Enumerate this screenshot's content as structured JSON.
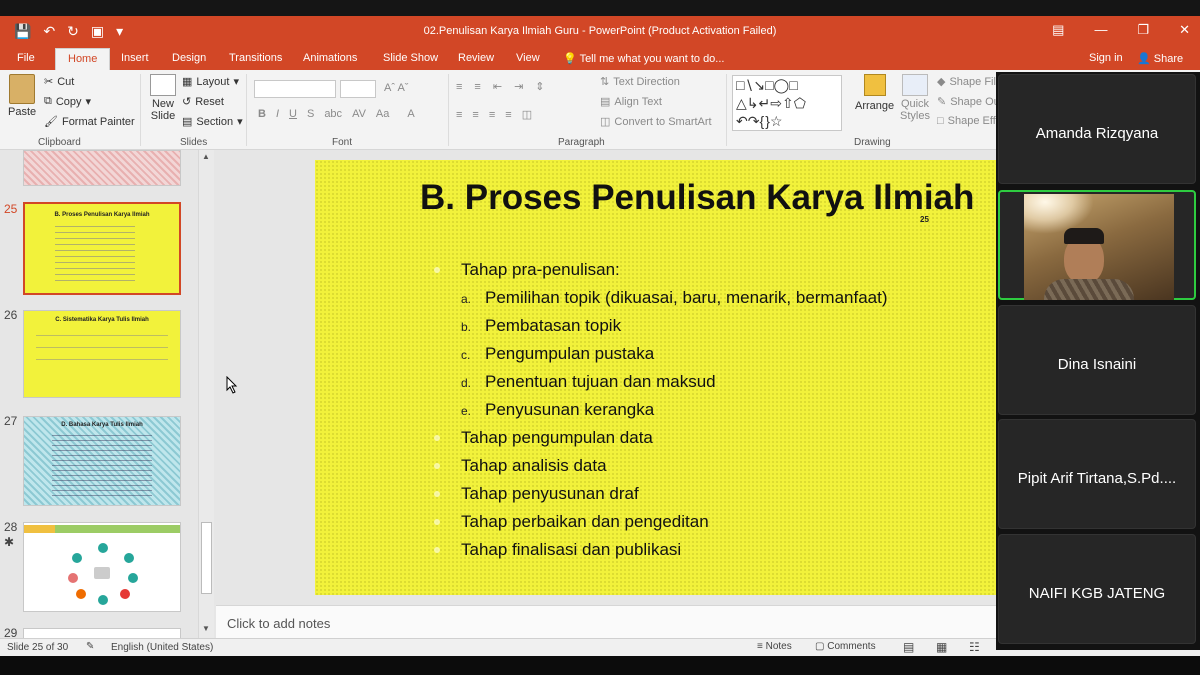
{
  "window": {
    "title": "02.Penulisan Karya Ilmiah Guru - PowerPoint (Product Activation Failed)"
  },
  "menu": {
    "tabs": [
      "File",
      "Home",
      "Insert",
      "Design",
      "Transitions",
      "Animations",
      "Slide Show",
      "Review",
      "View"
    ],
    "tell_me": "Tell me what you want to do...",
    "sign_in": "Sign in",
    "share": "Share"
  },
  "ribbon": {
    "clipboard": {
      "paste": "Paste",
      "cut": "Cut",
      "copy": "Copy",
      "format_painter": "Format Painter",
      "label": "Clipboard"
    },
    "slides": {
      "new_slide": "New Slide",
      "layout": "Layout",
      "reset": "Reset",
      "section": "Section",
      "label": "Slides"
    },
    "font": {
      "label": "Font",
      "case": "Aa"
    },
    "paragraph": {
      "text_direction": "Text Direction",
      "align_text": "Align Text",
      "convert": "Convert to SmartArt",
      "label": "Paragraph"
    },
    "drawing": {
      "arrange": "Arrange",
      "quick_styles": "Quick Styles",
      "shape_fill": "Shape Fill",
      "shape_outline": "Shape Outline",
      "shape_effects": "Shape Effects",
      "label": "Drawing"
    }
  },
  "thumbnails": [
    {
      "num": "25",
      "title": "B. Proses Penulisan Karya Ilmiah"
    },
    {
      "num": "26",
      "title": "C. Sistematika Karya Tulis Ilmiah"
    },
    {
      "num": "27",
      "title": "D. Bahasa Karya Tulis Ilmiah"
    },
    {
      "num": "28",
      "title": ""
    },
    {
      "num": "29",
      "title": ""
    }
  ],
  "slide": {
    "title": "B. Proses Penulisan Karya Ilmiah",
    "number": "25",
    "items": [
      "Tahap pra-penulisan:",
      "Pemilihan topik (dikuasai, baru, menarik, bermanfaat)",
      "Pembatasan topik",
      "Pengumpulan pustaka",
      "Penentuan tujuan dan maksud",
      "Penyusunan kerangka",
      "Tahap pengumpulan data",
      "Tahap analisis data",
      "Tahap penyusunan draf",
      "Tahap perbaikan dan pengeditan",
      "Tahap finalisasi dan publikasi"
    ],
    "markers": [
      "a.",
      "b.",
      "c.",
      "d.",
      "e."
    ]
  },
  "notes": {
    "placeholder": "Click to add notes"
  },
  "status": {
    "slide_of": "Slide 25 of 30",
    "language": "English (United States)",
    "notes_btn": "Notes",
    "comments_btn": "Comments"
  },
  "participants": [
    "Amanda Rizqyana",
    "",
    "Dina Isnaini",
    "Pipit Arif Tirtana,S.Pd....",
    "NAIFI KGB JATENG"
  ],
  "colors": {
    "accent": "#d24726",
    "slide_bg": "#f2f23b",
    "speaking": "#2ecc40"
  }
}
